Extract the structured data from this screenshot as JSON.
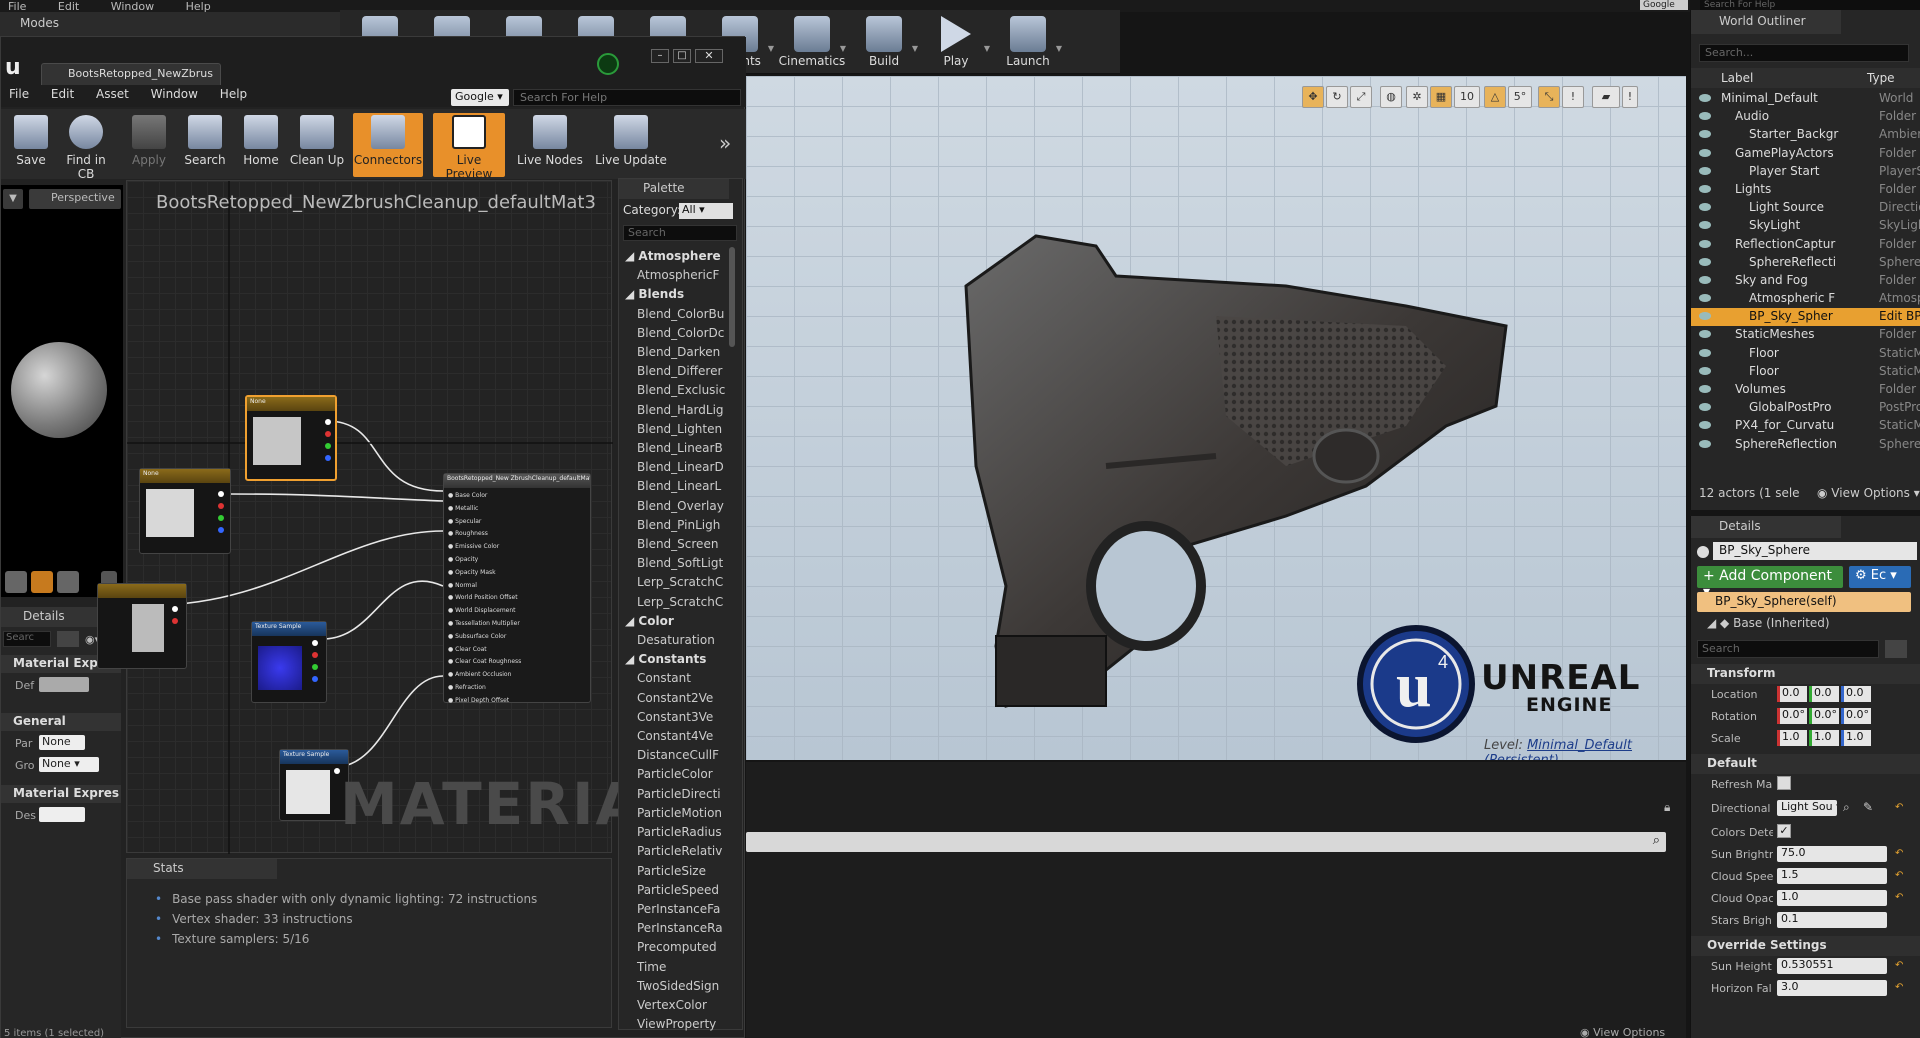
{
  "main_menu": [
    "File",
    "Edit",
    "Window",
    "Help"
  ],
  "modes_tab": "Modes",
  "main_toolbar": [
    {
      "label": "",
      "icon": "save-icon"
    },
    {
      "label": "",
      "icon": "source-control-icon"
    },
    {
      "label": "",
      "icon": "content-icon"
    },
    {
      "label": "",
      "icon": "marketplace-icon"
    },
    {
      "label": "",
      "icon": "settings-icon"
    },
    {
      "label": "eprints",
      "icon": "blueprints-icon"
    },
    {
      "label": "Cinematics",
      "icon": "cinematics-icon"
    },
    {
      "label": "Build",
      "icon": "build-icon"
    },
    {
      "label": "Play",
      "icon": "play-icon"
    },
    {
      "label": "Launch",
      "icon": "launch-icon"
    }
  ],
  "top_right": {
    "google": "Google",
    "search_placeholder": "Search For Help"
  },
  "material_editor": {
    "tab_title": "BootsRetopped_NewZbrus",
    "menu": [
      "File",
      "Edit",
      "Asset",
      "Window",
      "Help"
    ],
    "google": "Google",
    "help_placeholder": "Search For Help",
    "toolbar": [
      {
        "label": "Save",
        "state": "normal"
      },
      {
        "label": "Find in CB",
        "state": "normal"
      },
      {
        "label": "Apply",
        "state": "disabled"
      },
      {
        "label": "Search",
        "state": "normal"
      },
      {
        "label": "Home",
        "state": "normal"
      },
      {
        "label": "Clean Up",
        "state": "normal"
      },
      {
        "label": "Connectors",
        "state": "active"
      },
      {
        "label": "Live Preview",
        "state": "active"
      },
      {
        "label": "Live Nodes",
        "state": "normal"
      },
      {
        "label": "Live Update",
        "state": "normal"
      }
    ],
    "perspective": "Perspective",
    "graph_title": "BootsRetopped_NewZbrushCleanup_defaultMat3",
    "graph_watermark": "MATERIAL",
    "result_node_title": "BootsRetopped_New ZbrushCleanup_defaultMat3",
    "result_pins": [
      "Base Color",
      "Metallic",
      "Specular",
      "Roughness",
      "Emissive Color",
      "Opacity",
      "Opacity Mask",
      "Normal",
      "World Position Offset",
      "World Displacement",
      "Tessellation Multiplier",
      "Subsurface Color",
      "Clear Coat",
      "Clear Coat Roughness",
      "Ambient Occlusion",
      "Refraction",
      "Pixel Depth Offset"
    ],
    "node_texture_label": "Texture Sample",
    "node_uvs": "UVs",
    "node_none": "None",
    "details": {
      "tab": "Details",
      "search_placeholder": "Searc",
      "sec_material_expr": "Material Expres",
      "def_label": "Def",
      "sec_general": "General",
      "par_label": "Par",
      "par_value": "None",
      "gro_label": "Gro",
      "gro_value": "None",
      "sec_material_expr2": "Material Expres",
      "des_label": "Des"
    },
    "stats": {
      "tab": "Stats",
      "lines": [
        "Base pass shader with only dynamic lighting: 72 instructions",
        "Vertex shader: 33 instructions",
        "Texture samplers: 5/16"
      ]
    },
    "palette": {
      "tab": "Palette",
      "category_label": "Category:",
      "category_value": "All",
      "search_placeholder": "Search",
      "items": [
        {
          "type": "cat",
          "text": "Atmosphere"
        },
        {
          "type": "item",
          "text": "AtmosphericF"
        },
        {
          "type": "cat",
          "text": "Blends"
        },
        {
          "type": "item",
          "text": "Blend_ColorBu"
        },
        {
          "type": "item",
          "text": "Blend_ColorDc"
        },
        {
          "type": "item",
          "text": "Blend_Darken"
        },
        {
          "type": "item",
          "text": "Blend_Differer"
        },
        {
          "type": "item",
          "text": "Blend_Exclusic"
        },
        {
          "type": "item",
          "text": "Blend_HardLig"
        },
        {
          "type": "item",
          "text": "Blend_Lighten"
        },
        {
          "type": "item",
          "text": "Blend_LinearB"
        },
        {
          "type": "item",
          "text": "Blend_LinearD"
        },
        {
          "type": "item",
          "text": "Blend_LinearL"
        },
        {
          "type": "item",
          "text": "Blend_Overlay"
        },
        {
          "type": "item",
          "text": "Blend_PinLigh"
        },
        {
          "type": "item",
          "text": "Blend_Screen"
        },
        {
          "type": "item",
          "text": "Blend_SoftLigt"
        },
        {
          "type": "item",
          "text": "Lerp_ScratchC"
        },
        {
          "type": "item",
          "text": "Lerp_ScratchC"
        },
        {
          "type": "cat",
          "text": "Color"
        },
        {
          "type": "item",
          "text": "Desaturation"
        },
        {
          "type": "cat",
          "text": "Constants"
        },
        {
          "type": "item",
          "text": "Constant"
        },
        {
          "type": "item",
          "text": "Constant2Ve"
        },
        {
          "type": "item",
          "text": "Constant3Ve"
        },
        {
          "type": "item",
          "text": "Constant4Ve"
        },
        {
          "type": "item",
          "text": "DistanceCullF"
        },
        {
          "type": "item",
          "text": "ParticleColor"
        },
        {
          "type": "item",
          "text": "ParticleDirecti"
        },
        {
          "type": "item",
          "text": "ParticleMotion"
        },
        {
          "type": "item",
          "text": "ParticleRadius"
        },
        {
          "type": "item",
          "text": "ParticleRelativ"
        },
        {
          "type": "item",
          "text": "ParticleSize"
        },
        {
          "type": "item",
          "text": "ParticleSpeed"
        },
        {
          "type": "item",
          "text": "PerInstanceFa"
        },
        {
          "type": "item",
          "text": "PerInstanceRa"
        },
        {
          "type": "item",
          "text": "Precomputed"
        },
        {
          "type": "item",
          "text": "Time"
        },
        {
          "type": "item",
          "text": "TwoSidedSign"
        },
        {
          "type": "item",
          "text": "VertexColor"
        },
        {
          "type": "item",
          "text": "ViewProperty"
        }
      ]
    }
  },
  "viewport": {
    "toolbar_values": [
      "10",
      "5°"
    ],
    "logo_line1": "UNREAL",
    "logo_line2": "ENGINE",
    "level_prefix": "Level:",
    "level_name": "Minimal_Default (Persistent)"
  },
  "world_outliner": {
    "tab": "World Outliner",
    "search_placeholder": "Search...",
    "col_label": "Label",
    "col_type": "Type",
    "rows": [
      {
        "label": "Minimal_Default",
        "type": "World",
        "depth": 0,
        "selected": false
      },
      {
        "label": "Audio",
        "type": "Folder",
        "depth": 1,
        "selected": false
      },
      {
        "label": "Starter_Backgr",
        "type": "AmbientSo",
        "depth": 2,
        "selected": false
      },
      {
        "label": "GamePlayActors",
        "type": "Folder",
        "depth": 1,
        "selected": false
      },
      {
        "label": "Player Start",
        "type": "PlayerStar",
        "depth": 2,
        "selected": false
      },
      {
        "label": "Lights",
        "type": "Folder",
        "depth": 1,
        "selected": false
      },
      {
        "label": "Light Source",
        "type": "Directional",
        "depth": 2,
        "selected": false
      },
      {
        "label": "SkyLight",
        "type": "SkyLight",
        "depth": 2,
        "selected": false
      },
      {
        "label": "ReflectionCaptur",
        "type": "Folder",
        "depth": 1,
        "selected": false
      },
      {
        "label": "SphereReflecti",
        "type": "SphereRefl",
        "depth": 2,
        "selected": false
      },
      {
        "label": "Sky and Fog",
        "type": "Folder",
        "depth": 1,
        "selected": false
      },
      {
        "label": "Atmospheric F",
        "type": "Atmospher",
        "depth": 2,
        "selected": false
      },
      {
        "label": "BP_Sky_Spher",
        "type": "Edit BP_S",
        "depth": 2,
        "selected": true
      },
      {
        "label": "StaticMeshes",
        "type": "Folder",
        "depth": 1,
        "selected": false
      },
      {
        "label": "Floor",
        "type": "StaticMesh",
        "depth": 2,
        "selected": false
      },
      {
        "label": "Floor",
        "type": "StaticMesh",
        "depth": 2,
        "selected": false
      },
      {
        "label": "Volumes",
        "type": "Folder",
        "depth": 1,
        "selected": false
      },
      {
        "label": "GlobalPostPro",
        "type": "PostProce",
        "depth": 2,
        "selected": false
      },
      {
        "label": "PX4_for_Curvatu",
        "type": "StaticMesh",
        "depth": 1,
        "selected": false
      },
      {
        "label": "SphereReflection",
        "type": "SphereRefl",
        "depth": 1,
        "selected": false
      }
    ],
    "status": "12 actors (1 sele",
    "view_options": "View Options"
  },
  "details": {
    "tab": "Details",
    "actor_name": "BP_Sky_Sphere",
    "add_component": "+ Add Component",
    "edit_blueprint": "Ec",
    "component_self": "BP_Sky_Sphere(self)",
    "base_inherited": "Base (Inherited)",
    "search_placeholder": "Search",
    "transform_header": "Transform",
    "location_label": "Location",
    "location": [
      "0.0 c",
      "0.0 c",
      "0.0 c"
    ],
    "rotation_label": "Rotation",
    "rotation": [
      "0.0°",
      "0.0°",
      "0.0°"
    ],
    "scale_label": "Scale",
    "scale": [
      "1.0",
      "1.0",
      "1.0"
    ],
    "default_header": "Default",
    "refresh_label": "Refresh Ma",
    "directional_label": "Directional",
    "directional_value": "Light Sou",
    "colors_label": "Colors Dete",
    "sun_brightness_label": "Sun Brightr",
    "sun_brightness": "75.0",
    "cloud_speed_label": "Cloud Spee",
    "cloud_speed": "1.5",
    "cloud_opacity_label": "Cloud Opac",
    "cloud_opacity": "1.0",
    "stars_label": "Stars Brigh",
    "stars": "0.1",
    "override_header": "Override Settings",
    "sun_height_label": "Sun Height",
    "sun_height": "0.530551",
    "horizon_label": "Horizon Fal",
    "horizon": "3.0"
  },
  "content_browser": {
    "view_options": "View Options"
  },
  "status_bar": "5 items (1 selected)"
}
